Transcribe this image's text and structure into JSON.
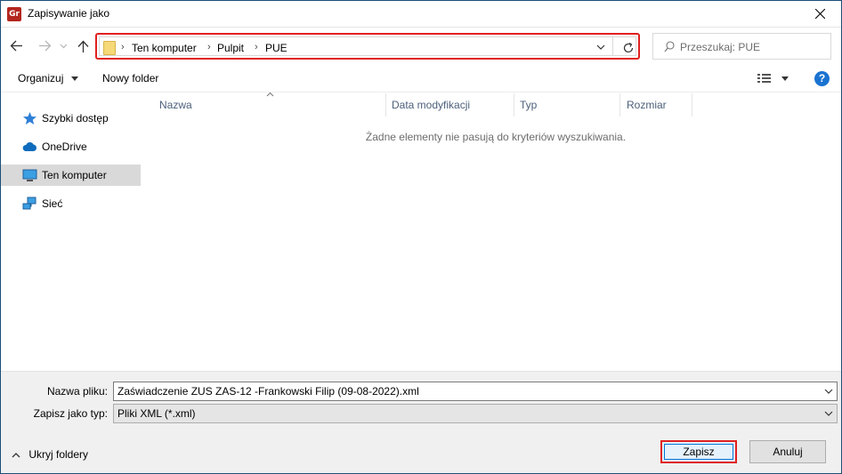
{
  "window": {
    "app_icon_text": "Gr",
    "title": "Zapisywanie jako"
  },
  "address_bar": {
    "crumbs": [
      "Ten komputer",
      "Pulpit",
      "PUE"
    ]
  },
  "search": {
    "placeholder": "Przeszukaj: PUE"
  },
  "toolbar": {
    "organize_label": "Organizuj",
    "new_folder_label": "Nowy folder",
    "help_label": "?"
  },
  "nav_pane": {
    "items": [
      {
        "label": "Szybki dostęp",
        "icon": "star-icon"
      },
      {
        "label": "OneDrive",
        "icon": "cloud-icon"
      },
      {
        "label": "Ten komputer",
        "icon": "computer-icon",
        "selected": true
      },
      {
        "label": "Sieć",
        "icon": "network-icon"
      }
    ]
  },
  "columns": {
    "name": "Nazwa",
    "modified": "Data modyfikacji",
    "type": "Typ",
    "size": "Rozmiar"
  },
  "content": {
    "empty_message": "Żadne elementy nie pasują do kryteriów wyszukiwania."
  },
  "form": {
    "filename_label": "Nazwa pliku:",
    "filename_value": "Zaświadczenie ZUS ZAS-12 -Frankowski Filip (09-08-2022).xml",
    "filetype_label": "Zapisz jako typ:",
    "filetype_value": "Pliki XML (*.xml)"
  },
  "footer": {
    "hide_folders_label": "Ukryj foldery",
    "save_label": "Zapisz",
    "cancel_label": "Anuluj"
  },
  "colors": {
    "highlight_border": "#e02020",
    "selected_nav": "#d9d9d9",
    "accent": "#0078d7",
    "help_blue": "#1a73d1"
  }
}
